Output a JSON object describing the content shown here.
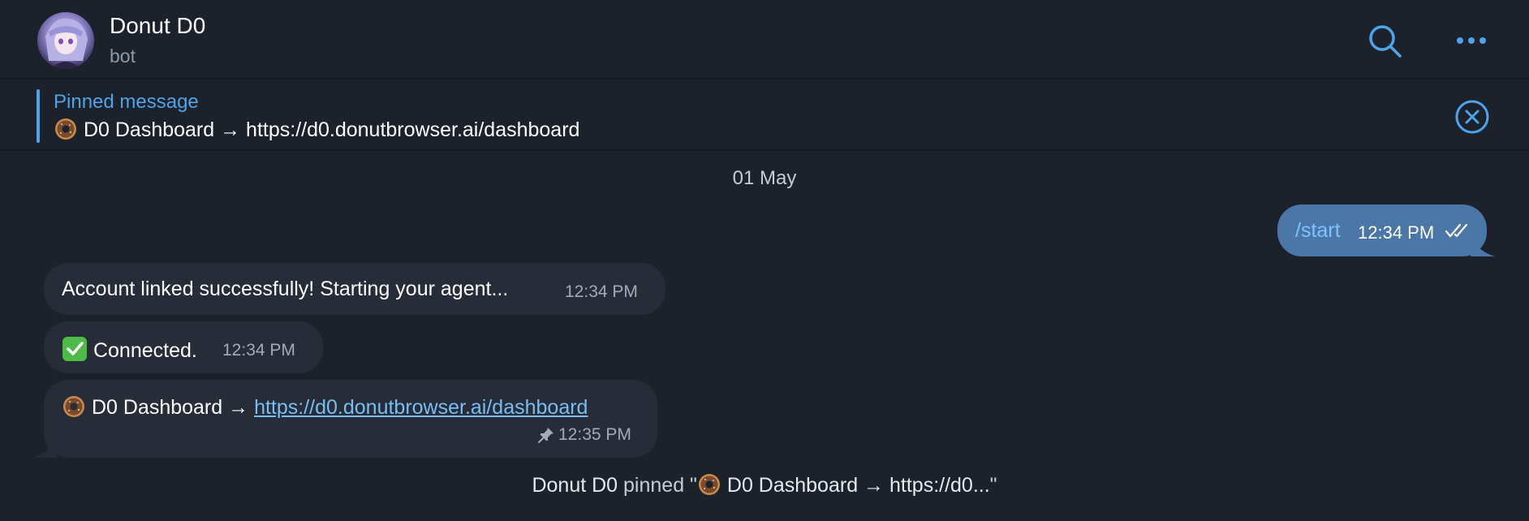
{
  "header": {
    "title": "Donut D0",
    "subtitle": "bot"
  },
  "pinned": {
    "title": "Pinned message",
    "text": "D0 Dashboard → https://d0.donutbrowser.ai/dashboard"
  },
  "date_separator": "01 May",
  "messages": {
    "outgoing": {
      "text": "/start",
      "time": "12:34 PM",
      "status_icon": "double-check-icon"
    },
    "incoming": [
      {
        "text": "Account linked successfully! Starting your agent...",
        "time": "12:34 PM"
      },
      {
        "text": "Connected.",
        "time": "12:34 PM",
        "emoji": "green-check-icon"
      },
      {
        "prefix": "D0 Dashboard → ",
        "link": "https://d0.donutbrowser.ai/dashboard",
        "time": "12:35 PM",
        "emoji": "donut-icon"
      }
    ]
  },
  "service_message": {
    "actor": "Donut D0",
    "action": "pinned \"",
    "quote": "D0 Dashboard → https://d0...",
    "suffix": "\""
  },
  "colors": {
    "background": "#1b222c",
    "accent": "#4fa3e8",
    "outgoing_bubble": "#4a76a8",
    "incoming_bubble": "#262d38"
  }
}
